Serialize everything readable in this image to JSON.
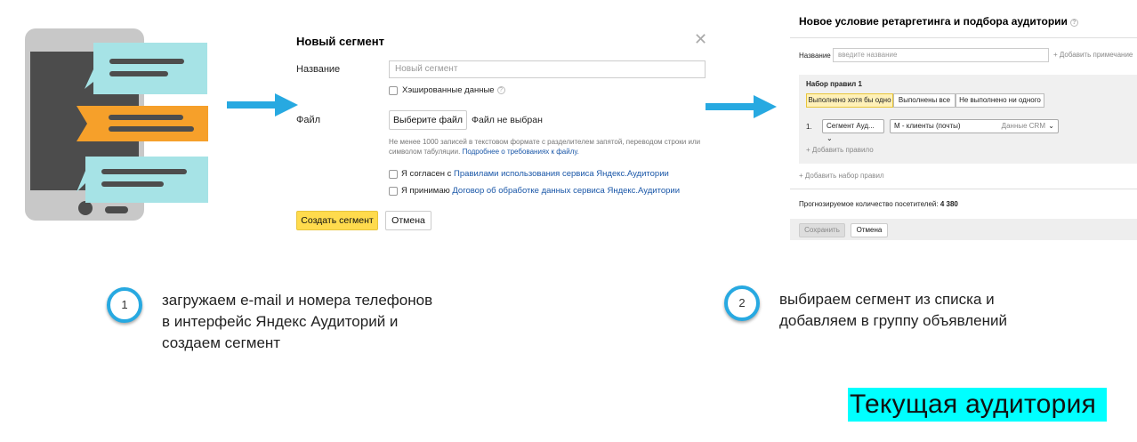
{
  "dialog1": {
    "title": "Новый сегмент",
    "name_label": "Название",
    "name_placeholder": "Новый сегмент",
    "hashed_label": "Хэшированные данные",
    "file_label": "Файл",
    "choose_file_button": "Выберите файл",
    "file_status": "Файл не выбран",
    "note_text": "Не менее 1000 записей в текстовом формате с разделителем запятой, переводом строки или",
    "note_text2": "символом табуляции.",
    "note_link": "Подробнее о требованиях к файлу.",
    "agree_prefix": "Я согласен с",
    "agree_link": "Правилами использования сервиса Яндекс.Аудитории",
    "accept_prefix": "Я принимаю",
    "accept_link": "Договор об обработке данных сервиса Яндекс.Аудитории",
    "create_button": "Создать сегмент",
    "cancel_button": "Отмена"
  },
  "dialog2": {
    "title": "Новое условие ретаргетинга и подбора аудитории",
    "name_label": "Название",
    "name_placeholder": "введите название",
    "add_note": "Добавить примечание",
    "ruleset_title": "Набор правил 1",
    "modes": [
      "Выполнено хотя бы одно",
      "Выполнены все",
      "Не выполнено ни одного"
    ],
    "rule_number": "1.",
    "rule_type": "Сегмент Ауд...",
    "rule_segment": "М - клиенты (почты)",
    "rule_source": "Данные CRM",
    "add_rule": "Добавить правило",
    "add_ruleset": "Добавить набор правил",
    "forecast_label": "Прогнозируемое количество посетителей:",
    "forecast_value": "4 380",
    "save_button": "Сохранить",
    "cancel_button": "Отмена"
  },
  "steps": [
    {
      "number": "1",
      "lines": [
        "загружаем e-mail и номера телефонов",
        "в интерфейс Яндекс Аудиторий и",
        "создаем сегмент"
      ]
    },
    {
      "number": "2",
      "lines": [
        "выбираем сегмент из списка и",
        "добавляем в группу объявлений"
      ]
    }
  ],
  "highlight_label": "Текущая аудитория",
  "colors": {
    "accent_blue": "#27a9e1",
    "bubble_cyan": "#a6e3e6",
    "bubble_orange": "#f6a02a",
    "phone_gray": "#c8c8c8",
    "highlight_cyan": "#00ffff",
    "yandex_yellow": "#ffdb4d"
  }
}
